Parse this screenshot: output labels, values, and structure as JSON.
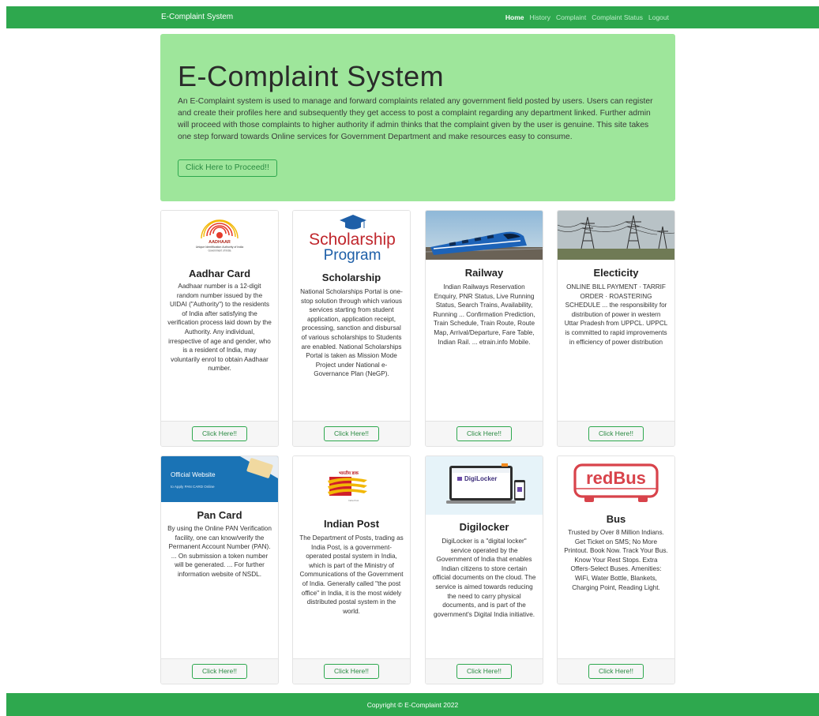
{
  "navbar": {
    "brand": "E-Complaint System",
    "links": [
      "Home",
      "History",
      "Complaint",
      "Complaint Status",
      "Logout"
    ]
  },
  "jumbotron": {
    "title": "E-Complaint System",
    "text": "An E-Complaint system is used to manage and forward complaints related any government field posted by users. Users can register and create their profiles here and subsequently they get access to post a complaint regarding any department linked. Further admin will proceed with those complaints to higher authority if admin thinks that the complaint given by the user is genuine. This site takes one step forward towards Online services for Government Department and make resources easy to consume.",
    "button": "Click Here to Proceed!!"
  },
  "cards": [
    {
      "title": "Aadhar Card",
      "icon": "aadhaar-logo",
      "image_text": [
        "AADHAAR",
        "Unique Identification Authority of India",
        "Government of India"
      ],
      "text": "Aadhaar number is a 12-digit random number issued by the UIDAI (\"Authority\") to the residents of India after satisfying the verification process laid down by the Authority. Any individual, irrespective of age and gender, who is a resident of India, may voluntarily enrol to obtain Aadhaar number.",
      "button": "Click Here!!"
    },
    {
      "title": "Scholarship",
      "icon": "scholarship-logo",
      "image_text": [
        "Scholarship",
        "Program"
      ],
      "text": "National Scholarships Portal is one-stop solution through which various services starting from student application, application receipt, processing, sanction and disbursal of various scholarships to Students are enabled. National Scholarships Portal is taken as Mission Mode Project under National e-Governance Plan (NeGP).",
      "button": "Click Here!!"
    },
    {
      "title": "Railway",
      "icon": "train-photo",
      "text": "Indian Railways Reservation Enquiry, PNR Status, Live Running Status, Search Trains, Availability, Running ... Confirmation Prediction, Train Schedule, Train Route, Route Map, Arrival/Departure, Fare Table, Indian Rail. ... etrain.info Mobile.",
      "button": "Click Here!!"
    },
    {
      "title": "Electicity",
      "icon": "power-tower-photo",
      "text": "ONLINE BILL PAYMENT · TARRIF ORDER · ROASTERING SCHEDULE ... the responsibility for distribution of power in western Uttar Pradesh from UPPCL. UPPCL is committed to rapid improvements in efficiency of power distribution",
      "button": "Click Here!!"
    },
    {
      "title": "Pan Card",
      "icon": "pan-card-banner",
      "image_text": [
        "Official Website",
        "to Apply PAN CARD Online"
      ],
      "text": "By using the Online PAN Verification facility, one can know/verify the Permanent Account Number (PAN). ... On submission a token number will be generated. ... For further information website of NSDL.",
      "button": "Click Here!!"
    },
    {
      "title": "Indian Post",
      "icon": "india-post-logo",
      "image_text": [
        "भारतीय डाक",
        "India Post"
      ],
      "text": "The Department of Posts, trading as India Post, is a government-operated postal system in India, which is part of the Ministry of Communications of the Government of India. Generally called \"the post office\" in India, it is the most widely distributed postal system in the world.",
      "button": "Click Here!!"
    },
    {
      "title": "Digilocker",
      "icon": "digilocker-devices",
      "image_text": [
        "DigiLocker"
      ],
      "text": "DigiLocker is a \"digital locker\" service operated by the Government of India that enables Indian citizens to store certain official documents on the cloud. The service is aimed towards reducing the need to carry physical documents, and is part of the government's Digital India initiative.",
      "button": "Click Here!!"
    },
    {
      "title": "Bus",
      "icon": "redbus-logo",
      "image_text": [
        "redBus"
      ],
      "text": "Trusted by Over 8 Million Indians. Get Ticket on SMS; No More Printout. Book Now. Track Your Bus. Know Your Rest Stops. Extra Offers-Select Buses. Amenities: WiFi, Water Bottle, Blankets, Charging Point, Reading Light.",
      "button": "Click Here!!"
    }
  ],
  "footer": {
    "text": "Copyright © E-Complaint 2022"
  },
  "colors": {
    "primary": "#2ea84e",
    "jumbotron": "#9ee69b",
    "button_text": "#2a8a42"
  }
}
